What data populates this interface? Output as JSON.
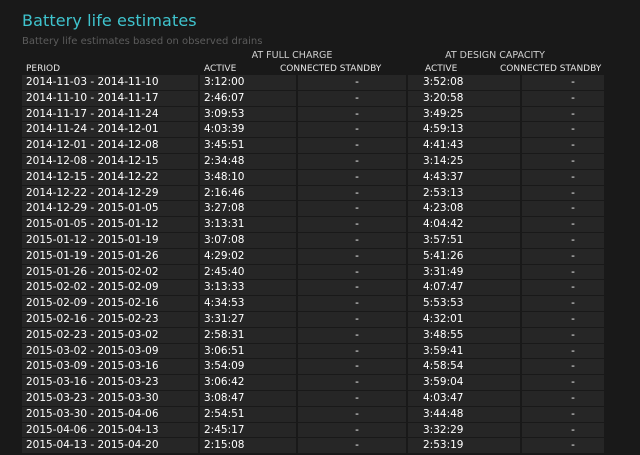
{
  "page": {
    "title": "Battery life estimates",
    "subtitle": "Battery life estimates based on observed drains"
  },
  "table": {
    "group_headers": {
      "full_charge": "AT FULL CHARGE",
      "design_capacity": "AT DESIGN CAPACITY"
    },
    "columns": {
      "period": "PERIOD",
      "full_active": "ACTIVE",
      "full_standby": "CONNECTED STANDBY",
      "design_active": "ACTIVE",
      "design_standby": "CONNECTED STANDBY"
    },
    "rows": [
      {
        "period": "2014-11-03 - 2014-11-10",
        "full_active": "3:12:00",
        "full_standby": "-",
        "design_active": "3:52:08",
        "design_standby": "-"
      },
      {
        "period": "2014-11-10 - 2014-11-17",
        "full_active": "2:46:07",
        "full_standby": "-",
        "design_active": "3:20:58",
        "design_standby": "-"
      },
      {
        "period": "2014-11-17 - 2014-11-24",
        "full_active": "3:09:53",
        "full_standby": "-",
        "design_active": "3:49:25",
        "design_standby": "-"
      },
      {
        "period": "2014-11-24 - 2014-12-01",
        "full_active": "4:03:39",
        "full_standby": "-",
        "design_active": "4:59:13",
        "design_standby": "-"
      },
      {
        "period": "2014-12-01 - 2014-12-08",
        "full_active": "3:45:51",
        "full_standby": "-",
        "design_active": "4:41:43",
        "design_standby": "-"
      },
      {
        "period": "2014-12-08 - 2014-12-15",
        "full_active": "2:34:48",
        "full_standby": "-",
        "design_active": "3:14:25",
        "design_standby": "-"
      },
      {
        "period": "2014-12-15 - 2014-12-22",
        "full_active": "3:48:10",
        "full_standby": "-",
        "design_active": "4:43:37",
        "design_standby": "-"
      },
      {
        "period": "2014-12-22 - 2014-12-29",
        "full_active": "2:16:46",
        "full_standby": "-",
        "design_active": "2:53:13",
        "design_standby": "-"
      },
      {
        "period": "2014-12-29 - 2015-01-05",
        "full_active": "3:27:08",
        "full_standby": "-",
        "design_active": "4:23:08",
        "design_standby": "-"
      },
      {
        "period": "2015-01-05 - 2015-01-12",
        "full_active": "3:13:31",
        "full_standby": "-",
        "design_active": "4:04:42",
        "design_standby": "-"
      },
      {
        "period": "2015-01-12 - 2015-01-19",
        "full_active": "3:07:08",
        "full_standby": "-",
        "design_active": "3:57:51",
        "design_standby": "-"
      },
      {
        "period": "2015-01-19 - 2015-01-26",
        "full_active": "4:29:02",
        "full_standby": "-",
        "design_active": "5:41:26",
        "design_standby": "-"
      },
      {
        "period": "2015-01-26 - 2015-02-02",
        "full_active": "2:45:40",
        "full_standby": "-",
        "design_active": "3:31:49",
        "design_standby": "-"
      },
      {
        "period": "2015-02-02 - 2015-02-09",
        "full_active": "3:13:33",
        "full_standby": "-",
        "design_active": "4:07:47",
        "design_standby": "-"
      },
      {
        "period": "2015-02-09 - 2015-02-16",
        "full_active": "4:34:53",
        "full_standby": "-",
        "design_active": "5:53:53",
        "design_standby": "-"
      },
      {
        "period": "2015-02-16 - 2015-02-23",
        "full_active": "3:31:27",
        "full_standby": "-",
        "design_active": "4:32:01",
        "design_standby": "-"
      },
      {
        "period": "2015-02-23 - 2015-03-02",
        "full_active": "2:58:31",
        "full_standby": "-",
        "design_active": "3:48:55",
        "design_standby": "-"
      },
      {
        "period": "2015-03-02 - 2015-03-09",
        "full_active": "3:06:51",
        "full_standby": "-",
        "design_active": "3:59:41",
        "design_standby": "-"
      },
      {
        "period": "2015-03-09 - 2015-03-16",
        "full_active": "3:54:09",
        "full_standby": "-",
        "design_active": "4:58:54",
        "design_standby": "-"
      },
      {
        "period": "2015-03-16 - 2015-03-23",
        "full_active": "3:06:42",
        "full_standby": "-",
        "design_active": "3:59:04",
        "design_standby": "-"
      },
      {
        "period": "2015-03-23 - 2015-03-30",
        "full_active": "3:08:47",
        "full_standby": "-",
        "design_active": "4:03:47",
        "design_standby": "-"
      },
      {
        "period": "2015-03-30 - 2015-04-06",
        "full_active": "2:54:51",
        "full_standby": "-",
        "design_active": "3:44:48",
        "design_standby": "-"
      },
      {
        "period": "2015-04-06 - 2015-04-13",
        "full_active": "2:45:17",
        "full_standby": "-",
        "design_active": "3:32:29",
        "design_standby": "-"
      },
      {
        "period": "2015-04-13 - 2015-04-20",
        "full_active": "2:15:08",
        "full_standby": "-",
        "design_active": "2:53:19",
        "design_standby": "-"
      }
    ]
  }
}
